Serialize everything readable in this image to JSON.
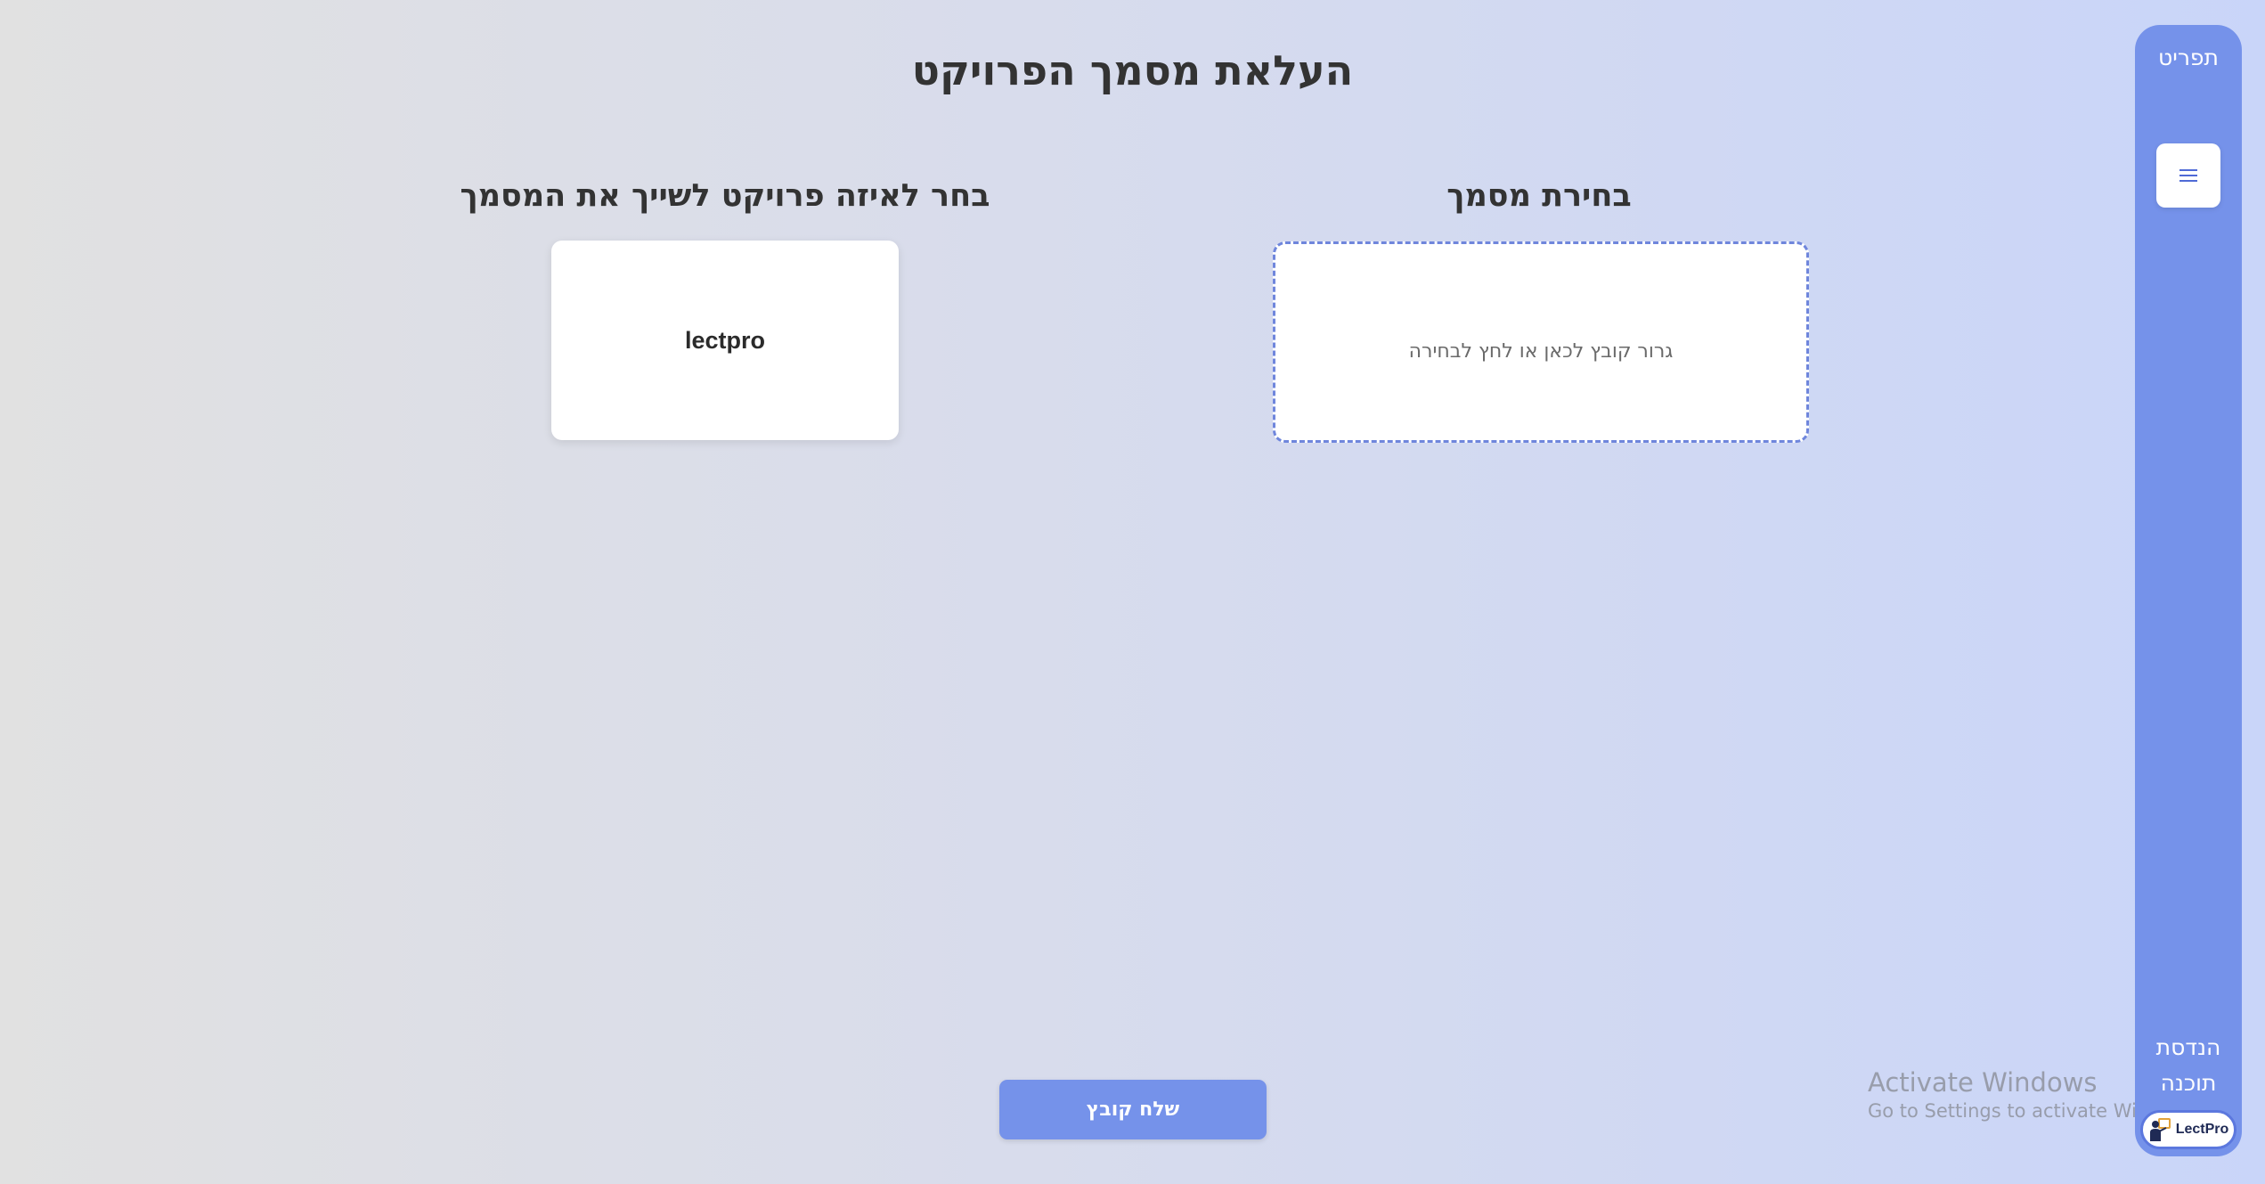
{
  "page": {
    "title": "העלאת מסמך הפרויקט"
  },
  "project_section": {
    "heading": "בחר לאיזה פרויקט לשייך את המסמך",
    "projects": [
      "lectpro"
    ]
  },
  "file_section": {
    "heading": "בחירת מסמך",
    "drop_zone_text": "גרור קובץ לכאן או לחץ לבחירה"
  },
  "send_button": {
    "label": "שלח קובץ"
  },
  "sidebar": {
    "title": "תפריט",
    "menu_icon": "hamburger-icon",
    "footer_line1": "הנדסת",
    "footer_line2": "תוכנה",
    "logo_text": "LectPro"
  },
  "watermark": {
    "title": "Activate Windows",
    "subtitle": "Go to Settings to activate Windows."
  },
  "colors": {
    "accent": "#7592ea",
    "drop_zone_border": "#6f86dc",
    "text": "#333333"
  }
}
